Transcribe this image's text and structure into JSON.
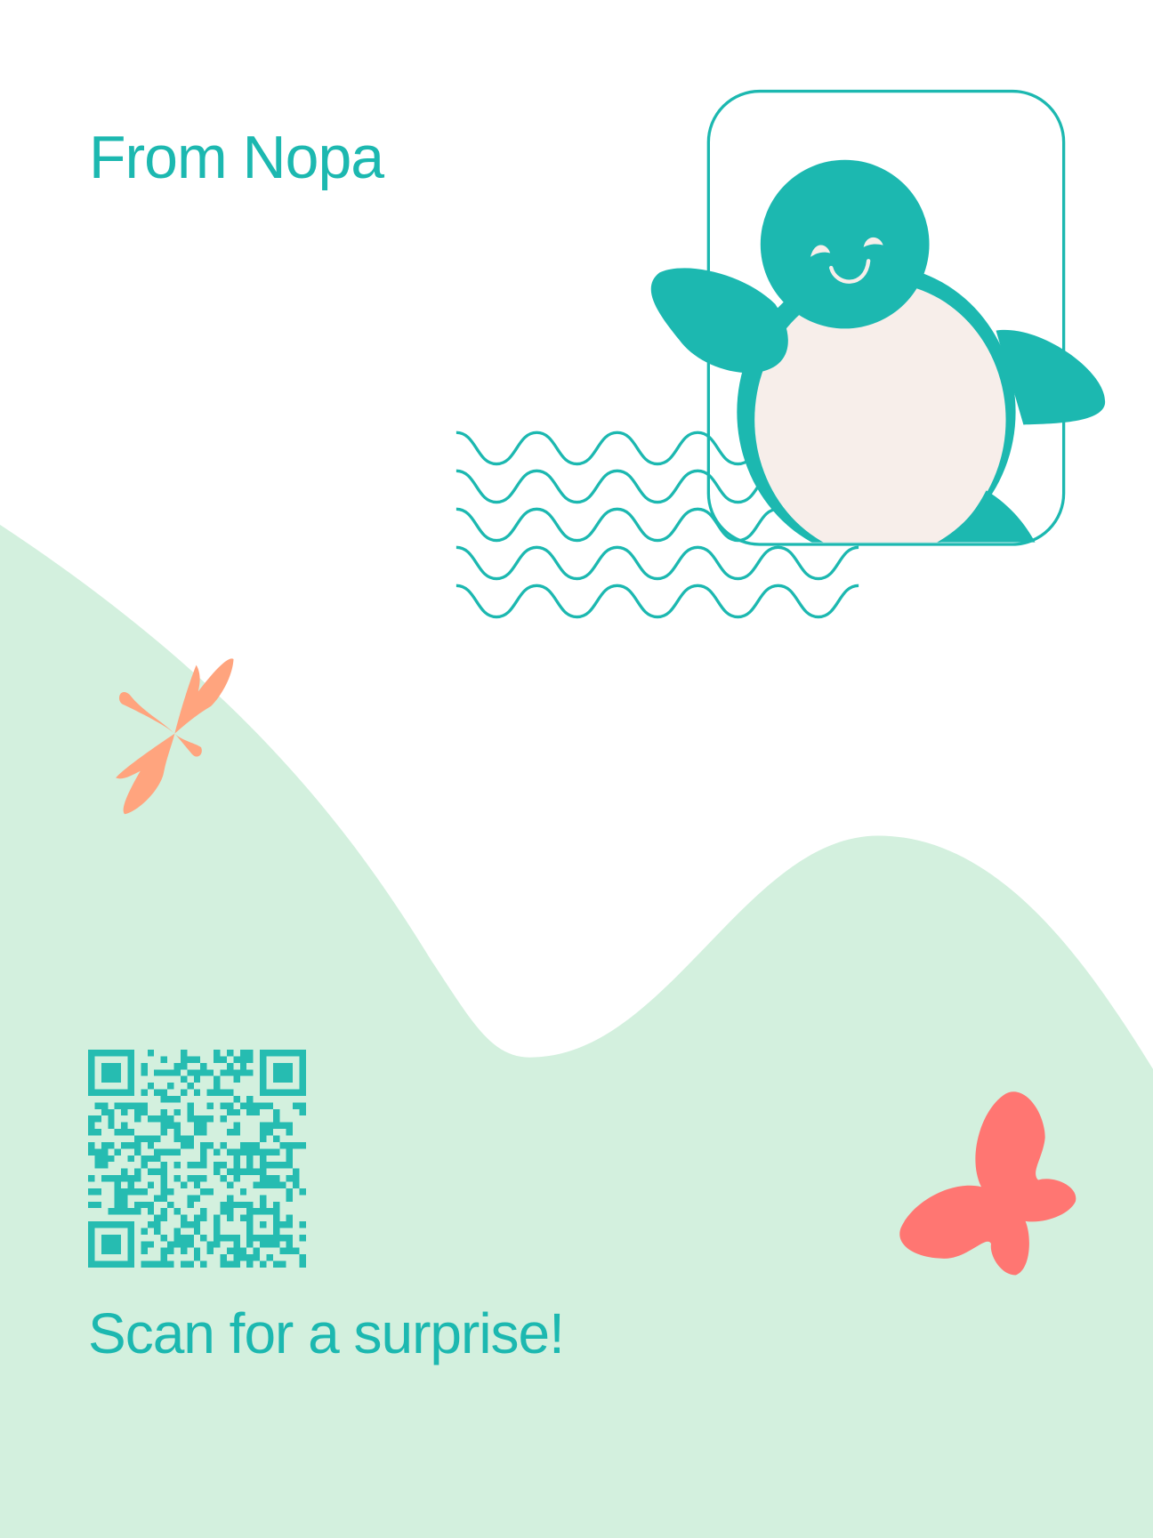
{
  "card": {
    "title": "From Nopa",
    "cta": "Scan for a surprise!"
  },
  "qr_code": {
    "icon": "qr-code-icon"
  },
  "illustrations": {
    "mascot": "penguin-in-frame-illustration",
    "waves": "waves-icon",
    "dragonfly": "dragonfly-icon",
    "butterfly": "butterfly-icon"
  },
  "colors": {
    "brand_teal": "#1cb8b0",
    "qr_teal": "#26bcb1",
    "hill_green": "#d3f0de",
    "belly_cream": "#f7eeea",
    "dragonfly_orange": "#ffa47e",
    "butterfly_coral": "#ff7672"
  }
}
